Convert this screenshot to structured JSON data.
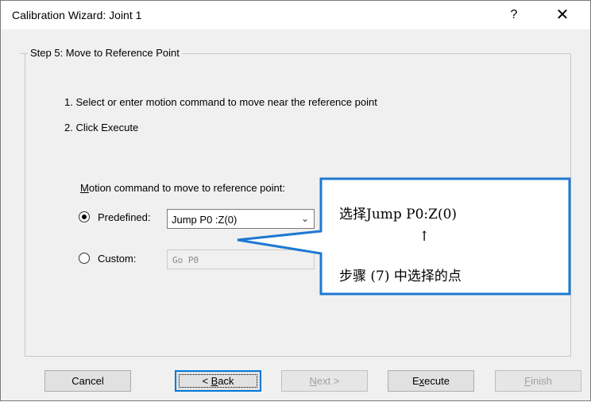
{
  "window": {
    "title": "Calibration Wizard: Joint 1",
    "help_glyph": "?",
    "close_glyph": "✕"
  },
  "group": {
    "legend": "Step 5: Move to Reference Point"
  },
  "instructions": {
    "line1": "1. Select or enter motion command to move near the reference point",
    "line2": "2. Click Execute"
  },
  "motion": {
    "label_first": "M",
    "label_rest": "otion command to move to reference point:",
    "predefined_label": "Predefined:",
    "predefined_value": "Jump P0 :Z(0)",
    "custom_label": "Custom:",
    "custom_value": "Go P0"
  },
  "callout": {
    "line1": "选择Jump P0:Z(0)",
    "arrow": "↑",
    "line2": "步骤 (7) 中选择的点",
    "border_color": "#1e78d2"
  },
  "buttons": {
    "cancel": "Cancel",
    "back_prefix": "< ",
    "back_accel": "B",
    "back_rest": "ack",
    "next_accel": "N",
    "next_rest": "ext >",
    "execute_prefix": "E",
    "execute_accel": "x",
    "execute_rest": "ecute",
    "finish_accel": "F",
    "finish_rest": "inish"
  }
}
